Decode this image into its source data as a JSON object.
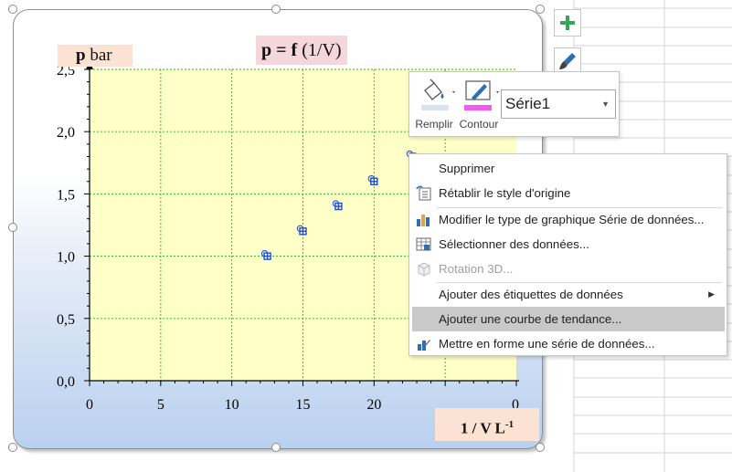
{
  "chart": {
    "title_main": "p = f",
    "title_rest": "(1/V)",
    "y_axis_symbol": "p",
    "y_axis_unit": "bar",
    "x_axis_label": "1 / V L",
    "x_axis_exp": "-1",
    "x_last_visible_tick": "0"
  },
  "chart_data": {
    "type": "scatter",
    "title": "p = f (1/V)",
    "xlabel": "1 / V L-1",
    "ylabel": "p bar",
    "xlim": [
      0,
      30
    ],
    "ylim": [
      0,
      2.5
    ],
    "x_ticks": [
      "0",
      "5",
      "10",
      "15",
      "20"
    ],
    "y_ticks": [
      "0,0",
      "0,5",
      "1,0",
      "1,5",
      "2,0",
      "2,5"
    ],
    "grid": true,
    "plot_background": "#ffffc8",
    "grid_color": "#22bb22",
    "marker_color": "#1f4fcf",
    "series": [
      {
        "name": "Série1",
        "x": [
          12.5,
          15.0,
          17.5,
          20.0,
          22.7
        ],
        "y": [
          1.0,
          1.2,
          1.4,
          1.6,
          1.8
        ]
      }
    ]
  },
  "format_toolbar": {
    "fill_label": "Remplir",
    "outline_label": "Contour",
    "series_selected": "Série1",
    "fill_icon": "paint-bucket-icon",
    "outline_icon": "pen-icon"
  },
  "side_buttons": {
    "add_icon": "plus-icon",
    "style_icon": "brush-icon"
  },
  "context_menu": {
    "items": [
      {
        "label": "Supprimer",
        "icon": ""
      },
      {
        "label": "Rétablir le style d'origine",
        "icon": "reset-style-icon"
      },
      {
        "label": "Modifier le type de graphique Série de données...",
        "icon": "chart-type-icon"
      },
      {
        "label": "Sélectionner des données...",
        "icon": "select-data-icon"
      },
      {
        "label": "Rotation 3D...",
        "icon": "rotation-3d-icon"
      },
      {
        "label": "Ajouter des étiquettes de données",
        "icon": ""
      },
      {
        "label": "Ajouter une courbe de tendance...",
        "icon": ""
      },
      {
        "label": "Mettre en forme une série de données...",
        "icon": "format-series-icon"
      }
    ],
    "highlight_color": "#c9c9c9"
  }
}
